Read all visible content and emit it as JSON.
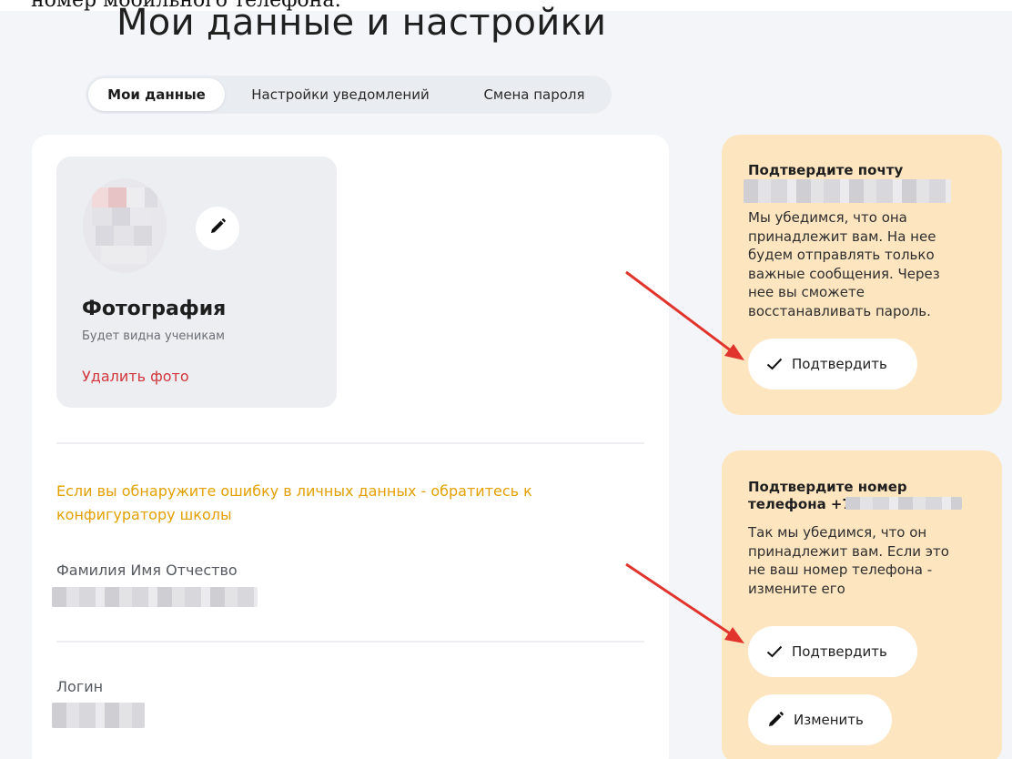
{
  "caption": "номер мобильного телефона:",
  "page_title": "Мои данные и настройки",
  "tabs": [
    {
      "label": "Мои данные",
      "active": true
    },
    {
      "label": "Настройки уведомлений",
      "active": false
    },
    {
      "label": "Смена пароля",
      "active": false
    }
  ],
  "photo": {
    "title": "Фотография",
    "subtitle": "Будет видна ученикам",
    "delete_label": "Удалить фото",
    "edit_icon": "pencil-icon"
  },
  "notice": "Если вы обнаружите ошибку в личных данных - обратитесь к конфигуратору школы",
  "fields": [
    {
      "label": "Фамилия Имя Отчество"
    },
    {
      "label": "Логин"
    }
  ],
  "email_card": {
    "title": "Подтвердите почту",
    "text": "Мы убедимся, что она принадлежит вам. На нее будем отправлять только важные сообщения. Через нее вы сможете восстанавливать пароль.",
    "confirm_label": "Подтвердить"
  },
  "phone_card": {
    "title_line1": "Подтвердите номер",
    "title_line2": "телефона +7",
    "text": "Так мы убедимся, что он принадлежит вам. Если это не ваш номер телефона - измените его",
    "confirm_label": "Подтвердить",
    "change_label": "Изменить"
  },
  "colors": {
    "background": "#f4f5f8",
    "side_card": "#fde5c0",
    "warning_text": "#e3a000",
    "delete_text": "#d1363c",
    "arrow": "#e0342c"
  }
}
